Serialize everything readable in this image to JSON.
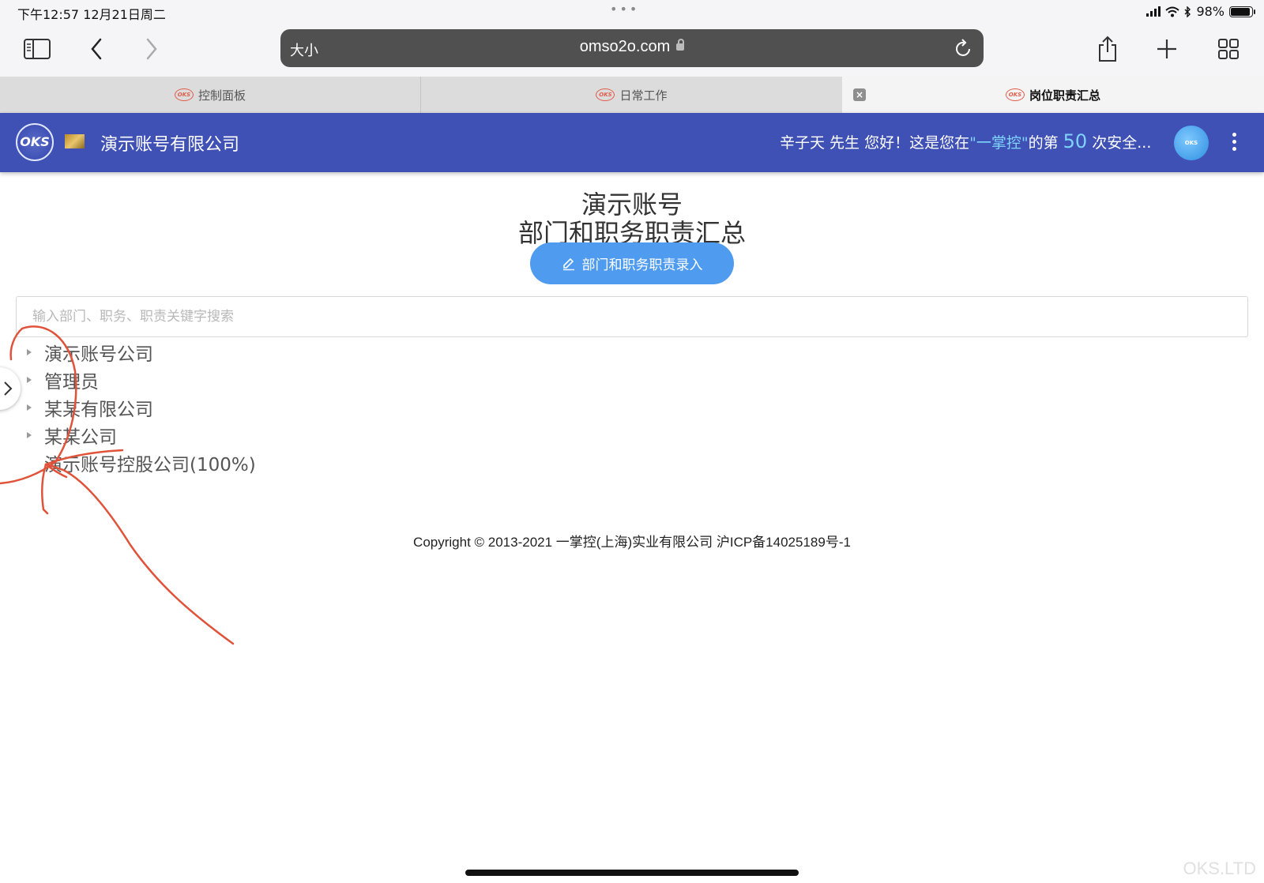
{
  "status_bar": {
    "time_date": "下午12:57   12月21日周二",
    "dots": "•••",
    "battery": "98%"
  },
  "browser": {
    "reader_label": "大小",
    "url": "omso2o.com",
    "tabs": [
      {
        "label": "控制面板"
      },
      {
        "label": "日常工作"
      },
      {
        "label": "岗位职责汇总"
      }
    ],
    "tab_close_glyph": "×"
  },
  "app_header": {
    "logo_text": "OKS",
    "company": "演示账号有限公司",
    "welcome_prefix": "辛子天 先生 您好！这是您在",
    "welcome_brand": "\"一掌控\"",
    "welcome_mid": "的第",
    "welcome_count": "50",
    "welcome_suffix": "次安全...",
    "avatar_text": "OKS"
  },
  "main": {
    "title_line1": "演示账号",
    "title_line2": "部门和职务职责汇总",
    "add_button_label": "部门和职务职责录入",
    "search_placeholder": "输入部门、职务、职责关键字搜索",
    "tree": [
      {
        "label": "演示账号公司"
      },
      {
        "label": "管理员"
      },
      {
        "label": "某某有限公司"
      },
      {
        "label": "某某公司"
      },
      {
        "label": "演示账号控股公司(100%)"
      }
    ]
  },
  "footer": {
    "copyright": "Copyright © 2013-2021 一掌控(上海)实业有限公司 沪ICP备14025189号-1",
    "watermark": "OKS.LTD"
  },
  "colors": {
    "header_bg": "#3f51b5",
    "button_bg": "#4e9bf0",
    "annotation": "#e0533a"
  }
}
